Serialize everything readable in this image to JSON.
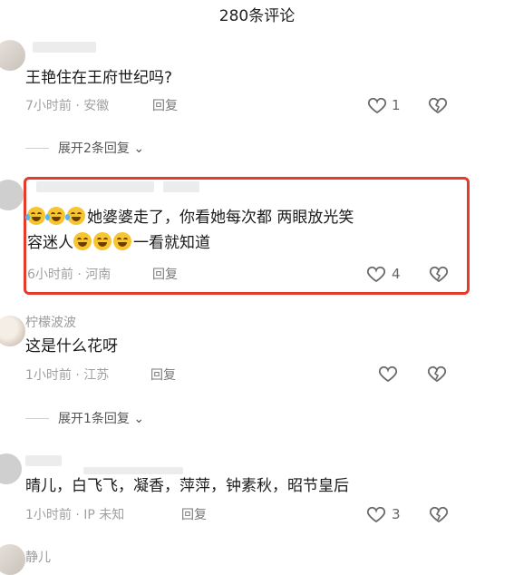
{
  "header": {
    "title": "280条评论"
  },
  "comments": [
    {
      "content": "王艳住在王府世纪吗?",
      "meta": "7小时前 · 安徽",
      "reply": "回复",
      "likes": "1",
      "expand": "展开2条回复"
    },
    {
      "content_line1": "她婆婆走了，你看她每次都 两眼放光笑",
      "content_line2_a": "容迷人",
      "content_line2_b": "一看就知道",
      "meta": "6小时前 · 河南",
      "reply": "回复",
      "likes": "4"
    },
    {
      "name": "柠檬波波",
      "content": "这是什么花呀",
      "meta": "1小时前 · 江苏",
      "reply": "回复",
      "expand": "展开1条回复"
    },
    {
      "content": "晴儿，白飞飞，凝香，萍萍，钟素秋，昭节皇后",
      "meta": "1小时前 · IP 未知",
      "reply": "回复",
      "likes": "3"
    },
    {
      "name": "静儿"
    }
  ],
  "icons": {
    "like": "heart-outline-icon",
    "dislike": "broken-heart-icon",
    "expand": "chevron-down-icon",
    "emoji_laugh": "laughing-tears-emoji",
    "emoji_grin": "grinning-sweat-emoji"
  },
  "colors": {
    "highlight": "#e63b2a"
  }
}
